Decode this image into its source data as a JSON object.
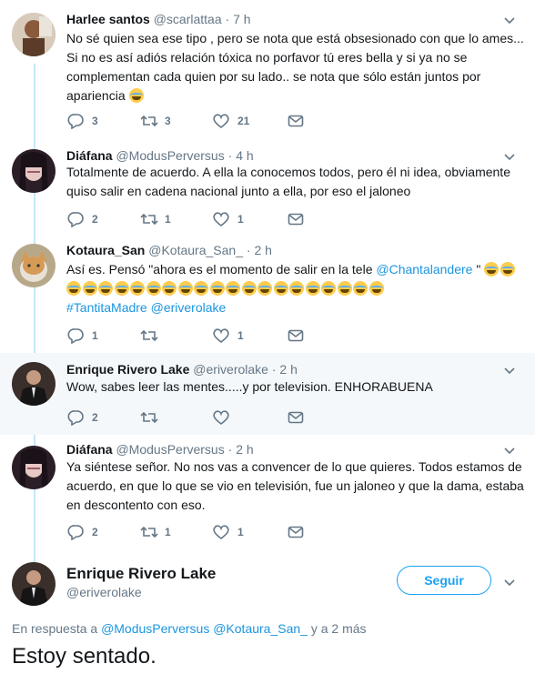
{
  "tweets": [
    {
      "name": "Harlee santos",
      "handle": "@scarlattaa",
      "time": "7 h",
      "text": "No sé quien sea ese tipo , pero se nota que está obsesionado con que lo ames... Si no es así adiós relación tóxica no porfavor tú eres bella y si ya no se complementan cada quien por su lado.. se nota que sólo están juntos por apariencia",
      "replies": "3",
      "retweets": "3",
      "likes": "21"
    },
    {
      "name": "Diáfana",
      "handle": "@ModusPerversus",
      "time": "4 h",
      "text": "Totalmente de acuerdo. A ella la conocemos todos, pero él ni idea, obviamente quiso salir en cadena nacional junto a ella, por eso el jaloneo",
      "replies": "2",
      "retweets": "1",
      "likes": "1"
    },
    {
      "name": "Kotaura_San",
      "handle": "@Kotaura_San_",
      "time": "2 h",
      "text_prefix": "Así es. Pensó \"ahora es el momento de salir en la tele ",
      "mention": "@Chantalandere",
      "text_suffix": " \"",
      "hashtag": "#TantitaMadre",
      "mention2": "@eriverolake",
      "replies": "1",
      "retweets": "",
      "likes": "1"
    },
    {
      "name": "Enrique Rivero Lake",
      "handle": "@eriverolake",
      "time": "2 h",
      "text": "Wow, sabes leer las mentes.....y por television. ENHORABUENA",
      "replies": "2",
      "retweets": "",
      "likes": ""
    },
    {
      "name": "Diáfana",
      "handle": "@ModusPerversus",
      "time": "2 h",
      "text": "Ya siéntese señor. No nos vas a convencer de lo que quieres. Todos estamos de acuerdo, en que lo que se vio en televisión, fue un jaloneo y que la dama, estaba en descontento con eso.",
      "replies": "2",
      "retweets": "1",
      "likes": "1"
    }
  ],
  "main_tweet": {
    "name": "Enrique Rivero Lake",
    "handle": "@eriverolake",
    "follow_label": "Seguir",
    "reply_prefix": "En respuesta a",
    "reply_mention1": "@ModusPerversus",
    "reply_mention2": "@Kotaura_San_",
    "reply_suffix": "y a 2 más",
    "text": "Estoy sentado."
  },
  "colors": {
    "accent": "#1da1f2",
    "link": "#1b95e0",
    "secondary": "#657786",
    "highlight_bg": "#f5f8fa",
    "thread_line": "#c4e7f9"
  }
}
